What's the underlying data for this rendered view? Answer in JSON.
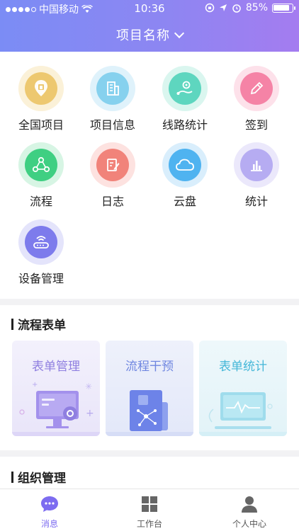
{
  "status_bar": {
    "carrier": "中国移动",
    "time": "10:36",
    "battery": "85%"
  },
  "header": {
    "title": "项目名称"
  },
  "grid": [
    {
      "label": "全国项目",
      "icon": "location-icon",
      "ring": "#fbf1d8",
      "core": "#edc870"
    },
    {
      "label": "项目信息",
      "icon": "building-icon",
      "ring": "#dff2fb",
      "core": "#86d1ee"
    },
    {
      "label": "线路统计",
      "icon": "route-icon",
      "ring": "#daf6ef",
      "core": "#5ed6bf"
    },
    {
      "label": "签到",
      "icon": "pencil-icon",
      "ring": "#fde1ea",
      "core": "#f583a6"
    },
    {
      "label": "流程",
      "icon": "flow-icon",
      "ring": "#d7f5e4",
      "core": "#3fcf82"
    },
    {
      "label": "日志",
      "icon": "journal-icon",
      "ring": "#fde2e0",
      "core": "#f1837a"
    },
    {
      "label": "云盘",
      "icon": "cloud-icon",
      "ring": "#d9eefc",
      "core": "#4fb3f0"
    },
    {
      "label": "统计",
      "icon": "bar-chart-icon",
      "ring": "#ebe8fb",
      "core": "#b6acf2"
    },
    {
      "label": "设备管理",
      "icon": "router-icon",
      "ring": "#e4e4fb",
      "core": "#7d7bec"
    }
  ],
  "sections": {
    "workflow": "流程表单",
    "org": "组织管理"
  },
  "cards": [
    {
      "label": "表单管理",
      "icon": "form-manage-illustration",
      "color": "#8f7fe0"
    },
    {
      "label": "流程干预",
      "icon": "flow-intervene-illustration",
      "color": "#5f7fe0"
    },
    {
      "label": "表单统计",
      "icon": "form-stats-illustration",
      "color": "#3fb3d8"
    }
  ],
  "tabs": [
    {
      "label": "消息",
      "icon": "message-icon",
      "active": true
    },
    {
      "label": "工作台",
      "icon": "dashboard-icon",
      "active": false
    },
    {
      "label": "个人中心",
      "icon": "person-icon",
      "active": false
    }
  ],
  "colors": {
    "accent": "#7d6cf0",
    "tab_inactive": "#555555"
  }
}
